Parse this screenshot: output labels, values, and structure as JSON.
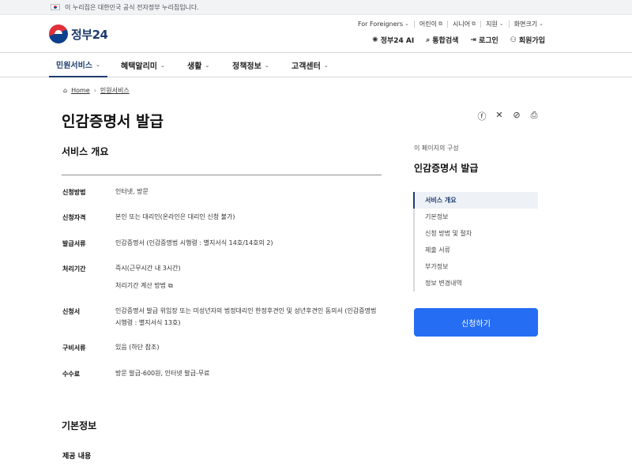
{
  "banner": {
    "text": "이 누리집은 대한민국 공식 전자정부 누리집입니다."
  },
  "logo": {
    "name": "정부",
    "num": "24"
  },
  "util_links": [
    {
      "label": "For Foreigners",
      "icon": "chevron-down-icon"
    },
    {
      "label": "어린이",
      "icon": "external-link-icon"
    },
    {
      "label": "시니어",
      "icon": "external-link-icon"
    },
    {
      "label": "지원",
      "icon": "chevron-down-icon"
    },
    {
      "label": "화면크기",
      "icon": "chevron-down-icon"
    }
  ],
  "main_links": [
    {
      "label": "정부24 AI",
      "icon": "ai-icon"
    },
    {
      "label": "통합검색",
      "icon": "search-icon"
    },
    {
      "label": "로그인",
      "icon": "login-icon"
    },
    {
      "label": "회원가입",
      "icon": "user-plus-icon"
    }
  ],
  "nav": [
    {
      "label": "민원서비스"
    },
    {
      "label": "혜택알리미"
    },
    {
      "label": "생활"
    },
    {
      "label": "정책정보"
    },
    {
      "label": "고객센터"
    }
  ],
  "breadcrumb": {
    "home": "Home",
    "current": "민원서비스"
  },
  "page": {
    "title": "인감증명서 발급"
  },
  "overview": {
    "heading": "서비스 개요",
    "rows": [
      {
        "label": "신청방법",
        "value": "인터넷, 방문"
      },
      {
        "label": "신청자격",
        "value": "본인 또는 대리인(온라인은 대리인 신청 불가)"
      },
      {
        "label": "발급서류",
        "value": "인감증명서 (인감증명법 시행령 : 별지서식 14호/14호의 2)"
      },
      {
        "label": "처리기간",
        "value": "즉시(근무시간 내 3시간)",
        "extra": "처리기간 계산 방법"
      },
      {
        "label": "신청서",
        "value": "인감증명서 발급 위임장 또는 미성년자의 법정대리인 한정후견인 및 성년후견인 동의서 (인감증명법 시행령 : 별지서식 13호)"
      },
      {
        "label": "구비서류",
        "value": "있음 (하단 참조)"
      },
      {
        "label": "수수료",
        "value": "방문 발급-600원, 인터넷 발급-무료"
      }
    ]
  },
  "basic_info": {
    "heading": "기본정보",
    "sub": "제공 내용"
  },
  "aside": {
    "caption": "이 페이지의 구성",
    "title": "인감증명서 발급",
    "toc": [
      "서비스 개요",
      "기본정보",
      "신청 방법 및 절차",
      "제출 서류",
      "부가정보",
      "정보 변경내역"
    ],
    "apply": "신청하기"
  }
}
